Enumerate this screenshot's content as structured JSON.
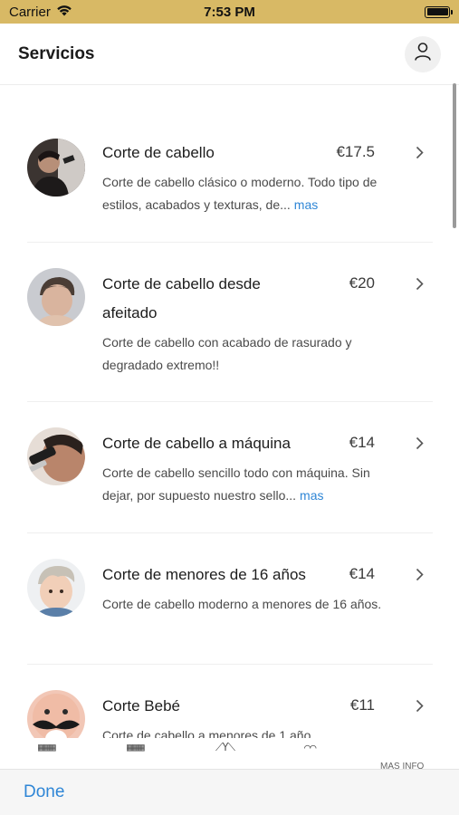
{
  "status_bar": {
    "carrier": "Carrier",
    "time": "7:53 PM"
  },
  "header": {
    "title": "Servicios",
    "profile_icon": "user-icon"
  },
  "services": [
    {
      "name": "Corte de cabello",
      "price": "€17.5",
      "description": "Corte de cabello clásico o moderno. Todo tipo de estilos, acabados y texturas, de...",
      "more": "mas"
    },
    {
      "name": "Corte de cabello desde afeitado",
      "price": "€20",
      "description": "Corte de cabello con acabado de rasurado y degradado extremo!!",
      "more": ""
    },
    {
      "name": "Corte de cabello a máquina",
      "price": "€14",
      "description": "Corte de cabello sencillo todo con máquina. Sin dejar, por supuesto nuestro sello...",
      "more": "mas"
    },
    {
      "name": "Corte de menores de 16 años",
      "price": "€14",
      "description": "Corte de cabello moderno a menores de 16 años.",
      "more": ""
    },
    {
      "name": "Corte Bebé",
      "price": "€11",
      "description": "Corte de cabello a menores de 1 año.",
      "more": ""
    }
  ],
  "tab_bar": {
    "last_label": "MAS INFO"
  },
  "accessory": {
    "done_label": "Done"
  },
  "colors": {
    "status_bar_bg": "#d8b965",
    "link": "#2f86d6"
  }
}
